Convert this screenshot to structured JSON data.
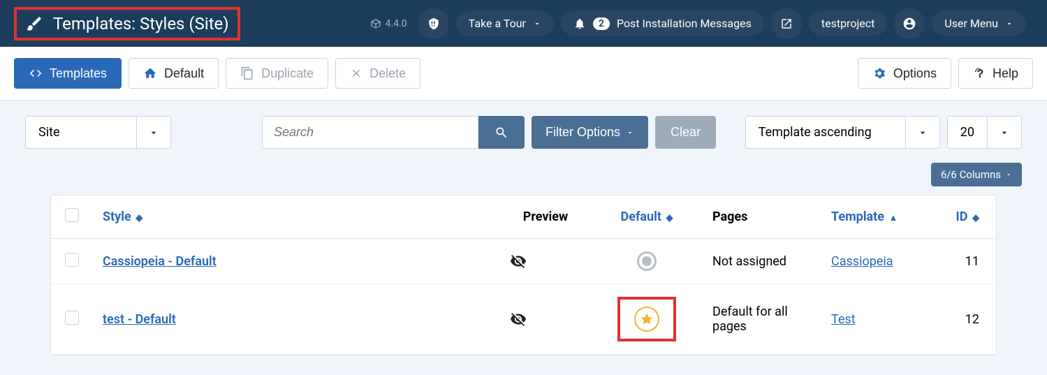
{
  "header": {
    "title": "Templates: Styles (Site)",
    "version": "4.4.0",
    "take_tour": "Take a Tour",
    "notifications_count": "2",
    "post_install": "Post Installation Messages",
    "project_name": "testproject",
    "user_menu": "User Menu"
  },
  "toolbar": {
    "templates": "Templates",
    "default": "Default",
    "duplicate": "Duplicate",
    "delete": "Delete",
    "options": "Options",
    "help": "Help"
  },
  "filters": {
    "scope": "Site",
    "search_placeholder": "Search",
    "filter_options": "Filter Options",
    "clear": "Clear",
    "sort": "Template ascending",
    "limit": "20",
    "columns": "6/6 Columns"
  },
  "columns": {
    "style": "Style",
    "preview": "Preview",
    "default": "Default",
    "pages": "Pages",
    "template": "Template",
    "id": "ID"
  },
  "rows": [
    {
      "style": "Cassiopeia - Default",
      "pages": "Not assigned",
      "template": "Cassiopeia",
      "id": "11",
      "is_default": false
    },
    {
      "style": "test - Default",
      "pages": "Default for all pages",
      "template": "Test",
      "id": "12",
      "is_default": true
    }
  ]
}
